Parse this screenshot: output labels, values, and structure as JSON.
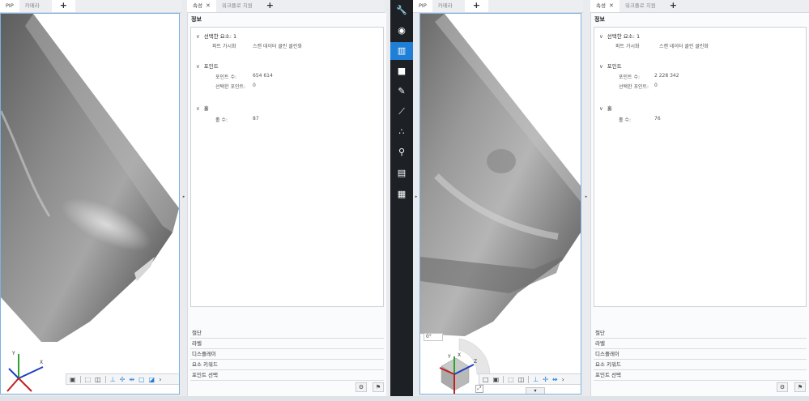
{
  "left": {
    "viewer_tabs": [
      {
        "label": "PIP"
      },
      {
        "label": "카메라"
      }
    ],
    "add_tab": "+",
    "panel_tabs": [
      {
        "label": "속성",
        "close": "✕"
      },
      {
        "label": "워크플로 지원"
      }
    ],
    "panel_add": "+",
    "panel_title": "정보",
    "groups": {
      "selected": {
        "title": "선택한 요소: 1",
        "rows": [
          {
            "label": "파트 가시화",
            "value": "스캔 데이터 클린 클린화"
          }
        ]
      },
      "points": {
        "title": "포인트",
        "rows": [
          {
            "label": "포인트 수:",
            "value": "654 614"
          },
          {
            "label": "선택한 포인트:",
            "value": "0"
          }
        ]
      },
      "holes": {
        "title": "홀",
        "rows": [
          {
            "label": "홀 수:",
            "value": "87"
          }
        ]
      }
    },
    "sections": [
      "절단",
      "라벨",
      "디스플레이",
      "요소 키워드",
      "포인트 선택"
    ]
  },
  "right": {
    "viewer_tabs": [
      {
        "label": "PIP"
      },
      {
        "label": "카메라"
      }
    ],
    "add_tab": "+",
    "panel_tabs": [
      {
        "label": "속성",
        "close": "✕"
      },
      {
        "label": "워크플로 지원"
      }
    ],
    "panel_add": "+",
    "panel_title": "정보",
    "groups": {
      "selected": {
        "title": "선택한 요소: 1",
        "rows": [
          {
            "label": "파트 가시화",
            "value": "스캔 데이터 클린 클린화"
          }
        ]
      },
      "points": {
        "title": "포인트",
        "rows": [
          {
            "label": "포인트 수:",
            "value": "2 228 342"
          },
          {
            "label": "선택한 포인트:",
            "value": "0"
          }
        ]
      },
      "holes": {
        "title": "홀",
        "rows": [
          {
            "label": "홀 수:",
            "value": "76"
          }
        ]
      }
    },
    "sections": [
      "절단",
      "라벨",
      "디스플레이",
      "요소 키워드",
      "포인트 선택"
    ],
    "angle_value": "0°"
  },
  "axis_labels": {
    "x": "X",
    "y": "Y",
    "z": "Z"
  },
  "icons": {
    "mid_toolbar": [
      "wrench-icon",
      "compass-icon",
      "columns-icon",
      "camera-icon",
      "brush-icon",
      "pen-icon",
      "nodes-icon",
      "search-icon",
      "document-icon",
      "grid-icon"
    ],
    "active_mid_toolbar_icon": "columns-icon"
  },
  "colors": {
    "accent": "#1f7fd6",
    "sidebar": "#1d2024",
    "viewport_border": "#7fb0e0"
  }
}
